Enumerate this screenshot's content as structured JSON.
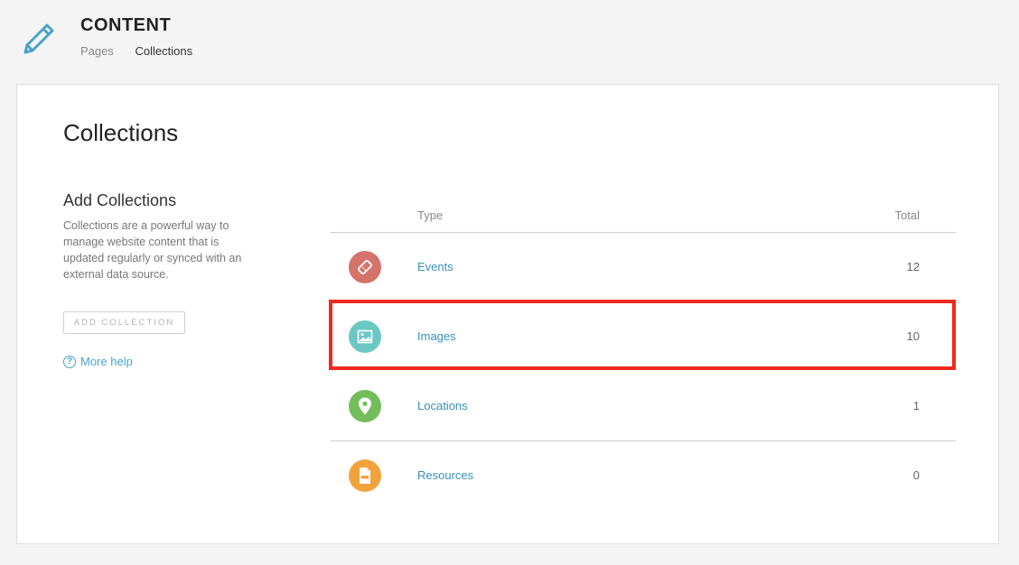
{
  "header": {
    "title": "CONTENT",
    "breadcrumb": [
      "Pages",
      "Collections"
    ],
    "icon": "pencil-icon",
    "accent": "#4aa3c9"
  },
  "main": {
    "title": "Collections",
    "sidebar": {
      "title": "Add Collections",
      "description": "Collections are a powerful way to manage website content that is updated regularly or synced with an external data source.",
      "add_button": "ADD COLLECTION",
      "help_link": "More help"
    },
    "table": {
      "columns": [
        "Type",
        "Total"
      ],
      "rows": [
        {
          "name": "Events",
          "total": "12",
          "icon": "ticket-icon",
          "color": "#d4736a"
        },
        {
          "name": "Images",
          "total": "10",
          "icon": "image-icon",
          "color": "#6cc7c4"
        },
        {
          "name": "Locations",
          "total": "1",
          "icon": "location-pin-icon",
          "color": "#74bd5b"
        },
        {
          "name": "Resources",
          "total": "0",
          "icon": "pdf-file-icon",
          "color": "#f2a23c"
        }
      ]
    },
    "highlight_color": "#f02a1e"
  }
}
